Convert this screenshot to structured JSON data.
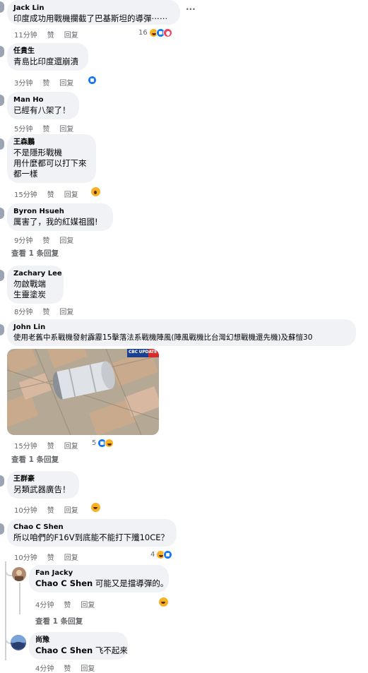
{
  "comments": [
    {
      "name": "Jack Lin",
      "lines": [
        "印度成功用戰機攔截了巴基斯坦的導彈⋯⋯"
      ],
      "time": "11分钟",
      "like": "赞",
      "reply": "回复",
      "count": "16"
    },
    {
      "name": "任貴生",
      "lines": [
        "青島比印度還崩潰"
      ],
      "time": "3分钟",
      "like": "赞",
      "reply": "回复"
    },
    {
      "name": "Man Ho",
      "lines": [
        "已經有八架了！"
      ],
      "time": "5分钟",
      "like": "赞",
      "reply": "回复"
    },
    {
      "name": "王森鵬",
      "lines": [
        "不是隱形戰機",
        "用什麼都可以打下來",
        "都一樣"
      ],
      "time": "15分钟",
      "like": "赞",
      "reply": "回复"
    },
    {
      "name": "Byron Hsueh",
      "lines": [
        "厲害了，我的紅媒祖國!"
      ],
      "time": "9分钟",
      "like": "赞",
      "reply": "回复",
      "see_replies": "查看 1 条回复"
    },
    {
      "name": "Zachary Lee",
      "lines": [
        "勿啟戰端",
        "生靈塗炭"
      ],
      "time": "8分钟",
      "like": "赞",
      "reply": "回复"
    },
    {
      "name": "John Lin",
      "lines": [
        "使用老舊中系戰機發射霹靂15擊落法系戰機陣風(陣風戰機比台灣幻想戰機還先機)及蘇愷30"
      ],
      "time": "15分钟",
      "like": "赞",
      "reply": "回复",
      "count": "5",
      "see_replies": "查看 1 条回复",
      "photo_logo": "CBC UPDATE"
    },
    {
      "name": "王群豪",
      "lines": [
        "另類武器廣告！"
      ],
      "time": "10分钟",
      "like": "赞",
      "reply": "回复"
    },
    {
      "name": "Chao C Shen",
      "lines": [
        "所以咱們的F16V到底能不能打下殲10CE？"
      ],
      "time": "10分钟",
      "like": "赞",
      "reply": "回复",
      "count": "4"
    }
  ],
  "replies": [
    {
      "name": "Fan Jacky",
      "mention": "Chao C Shen",
      "text": " 可能又是擋導彈的。",
      "time": "4分钟",
      "like": "赞",
      "reply": "回复",
      "see_replies": "查看 1 条回复"
    },
    {
      "name": "尚豫",
      "mention": "Chao C Shen",
      "text": " 飞不起来",
      "time": "4分钟",
      "like": "赞",
      "reply": "回复"
    }
  ],
  "more_menu": "···"
}
